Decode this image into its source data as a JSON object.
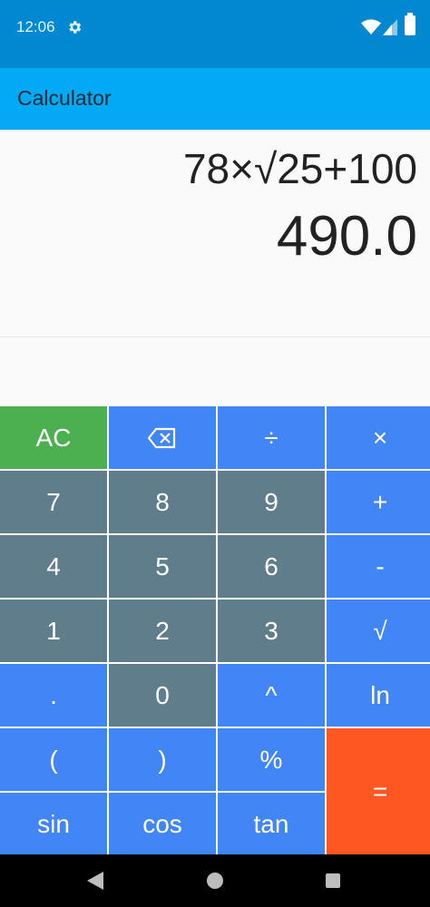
{
  "status_bar": {
    "time": "12:06",
    "icons": [
      "gear-icon",
      "wifi-icon",
      "cellular-icon",
      "battery-icon"
    ]
  },
  "app_bar": {
    "title": "Calculator"
  },
  "display": {
    "expression": "78×√25+100",
    "result": "490.0"
  },
  "colors": {
    "status_bar": "#0288d1",
    "app_bar": "#03a9f4",
    "key_blue": "#4285f4",
    "key_gray": "#607d8b",
    "key_green": "#4caf50",
    "key_orange": "#ff5722"
  },
  "keys": {
    "clear": "AC",
    "backspace_icon": "backspace-icon",
    "divide": "÷",
    "multiply": "×",
    "seven": "7",
    "eight": "8",
    "nine": "9",
    "plus": "+",
    "four": "4",
    "five": "5",
    "six": "6",
    "minus": "-",
    "one": "1",
    "two": "2",
    "three": "3",
    "sqrt": "√",
    "dot": ".",
    "zero": "0",
    "power": "^",
    "ln": "ln",
    "open_paren": "(",
    "close_paren": ")",
    "percent": "%",
    "equals": "=",
    "sin": "sin",
    "cos": "cos",
    "tan": "tan"
  },
  "nav_bar": {
    "icons": [
      "back-icon",
      "home-icon",
      "recents-icon"
    ]
  }
}
